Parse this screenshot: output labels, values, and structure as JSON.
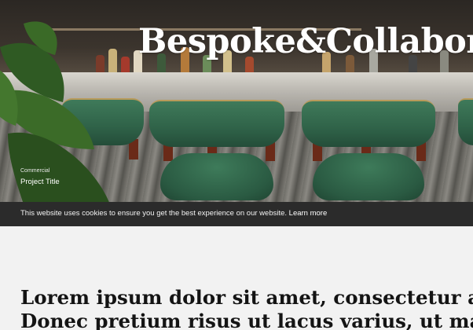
{
  "hero": {
    "title": "Bespoke&Collaborat",
    "category": "Commercial",
    "project_title": "Project Title"
  },
  "cookie_bar": {
    "message": "This website uses cookies to ensure you get the best experience on our website.",
    "link_label": "Learn more"
  },
  "content": {
    "lead_line_1": "Lorem ipsum dolor sit amet, consectetur adipi",
    "lead_line_2": "Donec pretium risus ut lacus varius, ut mattis s"
  },
  "colors": {
    "hero_title": "#ffffff",
    "cookie_bar_bg": "#2b2b2b",
    "page_bg": "#f2f2f2",
    "chair_leather": "#2f6248"
  }
}
